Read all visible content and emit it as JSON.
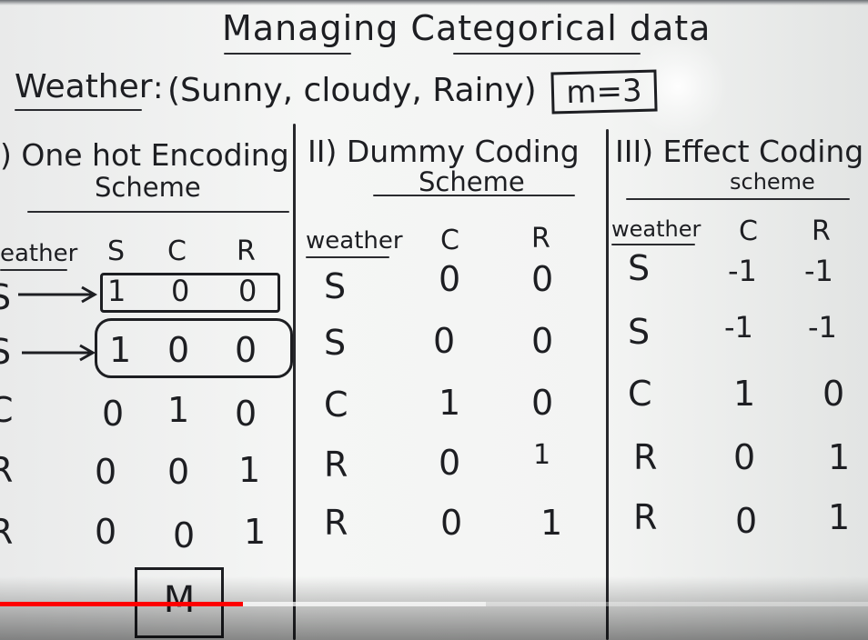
{
  "board": {
    "title": "Managing Categorical data",
    "weather_label": "Weather",
    "colon": ":",
    "values_text": "(Sunny, cloudy, Rainy)",
    "m_label": "m=3"
  },
  "one_hot": {
    "heading_line1": ") One hot Encoding",
    "heading_line2": "Scheme",
    "columns": [
      "eather",
      "S",
      "C",
      "R"
    ],
    "rows": [
      [
        "S",
        "1",
        "0",
        "0"
      ],
      [
        "S",
        "1",
        "0",
        "0"
      ],
      [
        "C",
        "0",
        "1",
        "0"
      ],
      [
        "R",
        "0",
        "0",
        "1"
      ],
      [
        "R",
        "0",
        "0",
        "1"
      ]
    ],
    "m_box_label": "M"
  },
  "dummy": {
    "heading_line1": "II) Dummy Coding",
    "heading_line2": "Scheme",
    "columns": [
      "weather",
      "C",
      "R"
    ],
    "rows": [
      [
        "S",
        "0",
        "0"
      ],
      [
        "S",
        "0",
        "0"
      ],
      [
        "C",
        "1",
        "0"
      ],
      [
        "R",
        "0",
        "1"
      ],
      [
        "R",
        "0",
        "1"
      ]
    ]
  },
  "effect": {
    "heading_line1": "III) Effect Coding",
    "heading_line2": "scheme",
    "columns": [
      "weather",
      "C",
      "R"
    ],
    "rows": [
      [
        "S",
        "-1",
        "-1"
      ],
      [
        "S",
        "-1",
        "-1"
      ],
      [
        "C",
        "1",
        "0"
      ],
      [
        "R",
        "0",
        "1"
      ],
      [
        "R",
        "0",
        "1"
      ]
    ]
  },
  "player": {
    "progress_fraction": 0.28,
    "buffered_fraction": 0.56,
    "progress_color": "#ff0000"
  }
}
